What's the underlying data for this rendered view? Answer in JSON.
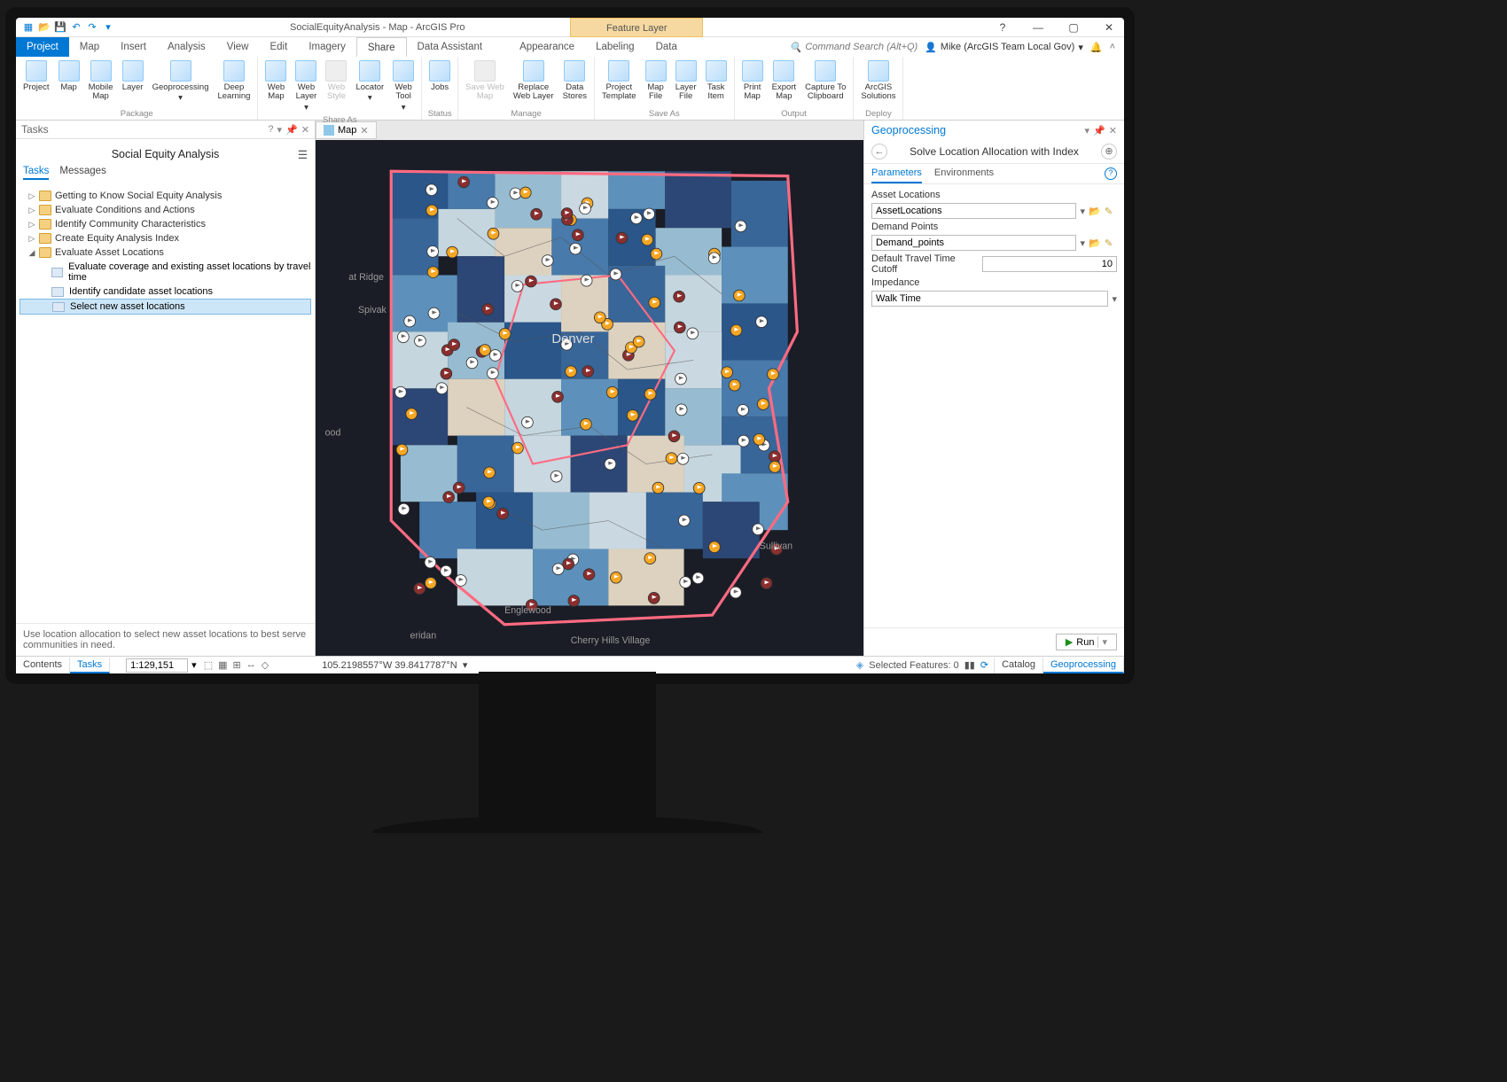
{
  "titlebar": {
    "title": "SocialEquityAnalysis - Map - ArcGIS Pro",
    "context_tab": "Feature Layer"
  },
  "menubar": {
    "project": "Project",
    "items": [
      "Map",
      "Insert",
      "Analysis",
      "View",
      "Edit",
      "Imagery",
      "Share",
      "Data Assistant"
    ],
    "active": "Share",
    "context_items": [
      "Appearance",
      "Labeling",
      "Data"
    ],
    "search_placeholder": "Command Search (Alt+Q)",
    "user": "Mike (ArcGIS Team Local Gov)"
  },
  "ribbon": {
    "groups": [
      {
        "label": "Package",
        "buttons": [
          {
            "label": "Project"
          },
          {
            "label": "Map"
          },
          {
            "label": "Mobile\nMap"
          },
          {
            "label": "Layer"
          },
          {
            "label": "Geoprocessing"
          },
          {
            "label": "Deep\nLearning"
          }
        ]
      },
      {
        "label": "Share As",
        "buttons": [
          {
            "label": "Web\nMap"
          },
          {
            "label": "Web\nLayer"
          },
          {
            "label": "Web\nStyle",
            "disabled": true
          },
          {
            "label": "Locator"
          },
          {
            "label": "Web\nTool"
          }
        ]
      },
      {
        "label": "Status",
        "buttons": [
          {
            "label": "Jobs"
          }
        ]
      },
      {
        "label": "Manage",
        "buttons": [
          {
            "label": "Save Web\nMap",
            "disabled": true
          },
          {
            "label": "Replace\nWeb Layer"
          },
          {
            "label": "Data\nStores"
          }
        ]
      },
      {
        "label": "Save As",
        "buttons": [
          {
            "label": "Project\nTemplate"
          },
          {
            "label": "Map\nFile"
          },
          {
            "label": "Layer\nFile"
          },
          {
            "label": "Task\nItem"
          }
        ]
      },
      {
        "label": "Output",
        "buttons": [
          {
            "label": "Print\nMap"
          },
          {
            "label": "Export\nMap"
          },
          {
            "label": "Capture To\nClipboard"
          }
        ]
      },
      {
        "label": "Deploy",
        "buttons": [
          {
            "label": "ArcGIS\nSolutions"
          }
        ]
      }
    ]
  },
  "tasks_pane": {
    "title": "Tasks",
    "subtitle": "Social Equity Analysis",
    "tabs": [
      "Tasks",
      "Messages"
    ],
    "active_tab": "Tasks",
    "tree": [
      {
        "label": "Getting to Know Social Equity Analysis",
        "expanded": false
      },
      {
        "label": "Evaluate Conditions and Actions",
        "expanded": false
      },
      {
        "label": "Identify Community Characteristics",
        "expanded": false
      },
      {
        "label": "Create Equity Analysis Index",
        "expanded": false
      },
      {
        "label": "Evaluate Asset Locations",
        "expanded": true,
        "children": [
          {
            "label": "Evaluate coverage and existing asset locations by travel time"
          },
          {
            "label": "Identify candidate asset locations"
          },
          {
            "label": "Select new asset locations",
            "selected": true
          }
        ]
      }
    ],
    "help_text": "Use location allocation to select new asset locations to best serve communities in need."
  },
  "map": {
    "tab_label": "Map",
    "center_label": "Denver",
    "labels": [
      "Spivak",
      "Englewood",
      "Cherry Hills Village",
      "Sullivan",
      "eridan"
    ]
  },
  "gp_pane": {
    "title": "Geoprocessing",
    "tool_title": "Solve Location Allocation with Index",
    "tabs": [
      "Parameters",
      "Environments"
    ],
    "active_tab": "Parameters",
    "params": {
      "asset_locations_label": "Asset Locations",
      "asset_locations_value": "AssetLocations",
      "demand_points_label": "Demand Points",
      "demand_points_value": "Demand_points",
      "cutoff_label": "Default Travel Time Cutoff",
      "cutoff_value": "10",
      "impedance_label": "Impedance",
      "impedance_value": "Walk Time"
    },
    "run_label": "Run"
  },
  "statusbar": {
    "left_tabs": [
      "Contents",
      "Tasks"
    ],
    "left_active": "Tasks",
    "scale": "1:129,151",
    "coords": "105.2198557°W 39.8417787°N",
    "selected_label": "Selected Features: 0",
    "right_tabs": [
      "Catalog",
      "Geoprocessing"
    ],
    "right_active": "Geoprocessing"
  }
}
